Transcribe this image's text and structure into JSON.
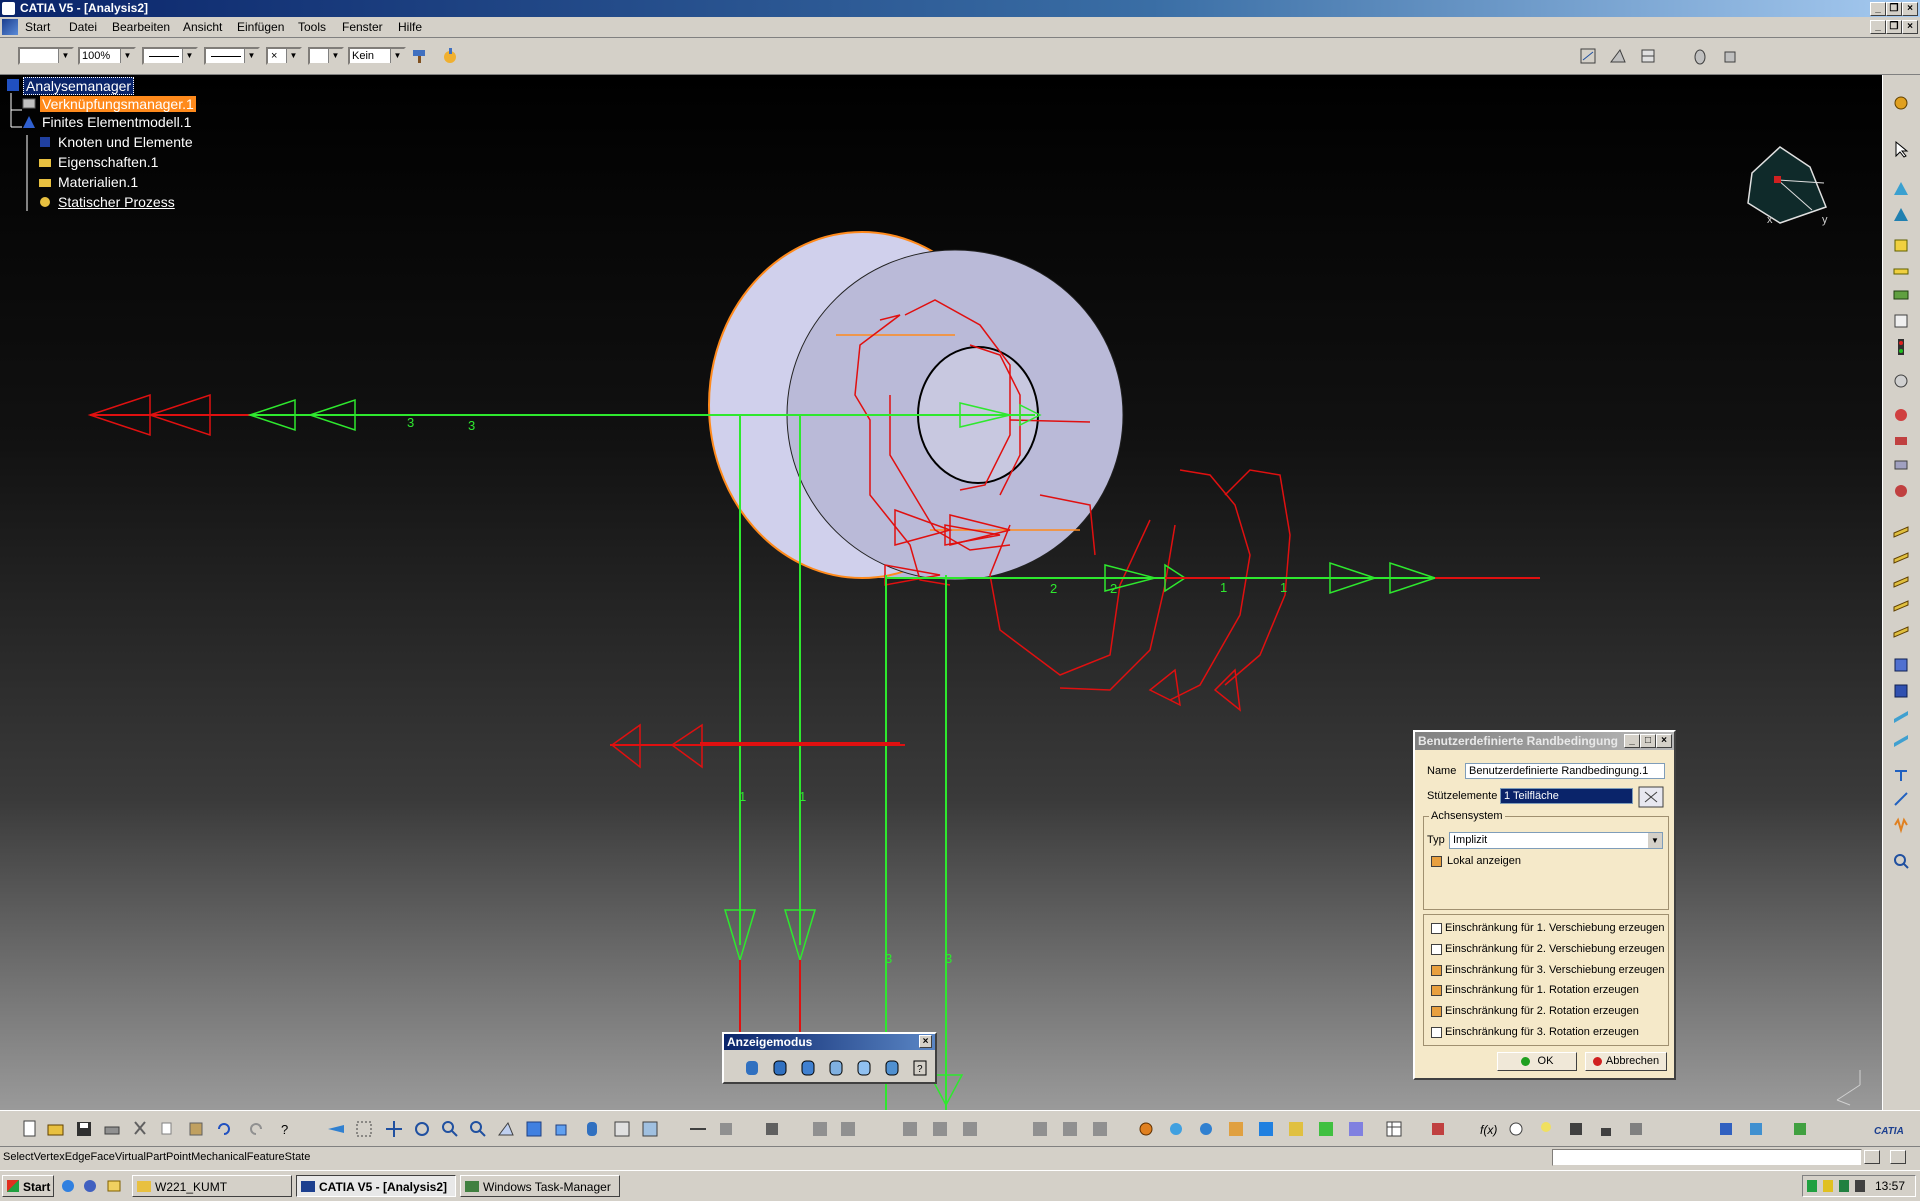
{
  "window": {
    "title": "CATIA V5 - [Analysis2]"
  },
  "menu": {
    "items": [
      "Start",
      "Datei",
      "Bearbeiten",
      "Ansicht",
      "Einfügen",
      "Tools",
      "Fenster",
      "Hilfe"
    ]
  },
  "toolbar": {
    "zoom_value": "100%",
    "layer_value": "Kein"
  },
  "tree": {
    "root": "Analysemanager",
    "link_manager": "Verknüpfungsmanager.1",
    "fe_model": "Finites Elementmodell.1",
    "nodes": "Knoten und Elemente",
    "properties": "Eigenschaften.1",
    "materials": "Materialien.1",
    "static_case": "Statischer Prozess"
  },
  "compass": {
    "x_label": "x",
    "y_label": "y"
  },
  "viewport": {
    "labels": [
      "3",
      "3",
      "2",
      "2",
      "1",
      "1",
      "1",
      "1",
      "3",
      "3"
    ]
  },
  "dialog": {
    "title": "Benutzerdefinierte Randbedingung",
    "name_label": "Name",
    "name_value": "Benutzerdefinierte Randbedingung.1",
    "support_label": "Stützelemente",
    "support_value": "1 Teilfläche",
    "axis_group": "Achsensystem",
    "type_label": "Typ",
    "type_value": "Implizit",
    "local_label": "Lokal anzeigen",
    "restrictions": [
      {
        "label": "Einschränkung für 1. Verschiebung erzeugen",
        "checked": false
      },
      {
        "label": "Einschränkung für 2. Verschiebung erzeugen",
        "checked": false
      },
      {
        "label": "Einschränkung für 3. Verschiebung erzeugen",
        "checked": true
      },
      {
        "label": "Einschränkung für 1. Rotation erzeugen",
        "checked": true
      },
      {
        "label": "Einschränkung für 2. Rotation erzeugen",
        "checked": true
      },
      {
        "label": "Einschränkung für 3. Rotation erzeugen",
        "checked": false
      }
    ],
    "ok_label": "OK",
    "cancel_label": "Abbrechen"
  },
  "display_mode": {
    "title": "Anzeigemodus"
  },
  "status": {
    "text": "SelectVertexEdgeFaceVirtualPartPointMechanicalFeatureState"
  },
  "taskbar": {
    "start": "Start",
    "tasks": [
      "W221_KUMT",
      "CATIA V5 - [Analysis2]",
      "Windows Task-Manager"
    ],
    "clock": "13:57"
  },
  "colors": {
    "accent": "#0a246a",
    "constraint_green": "#2ee82e",
    "constraint_red": "#e01010",
    "part_fill": "#c8c8e8",
    "selected_edge": "#ff8a1c"
  }
}
